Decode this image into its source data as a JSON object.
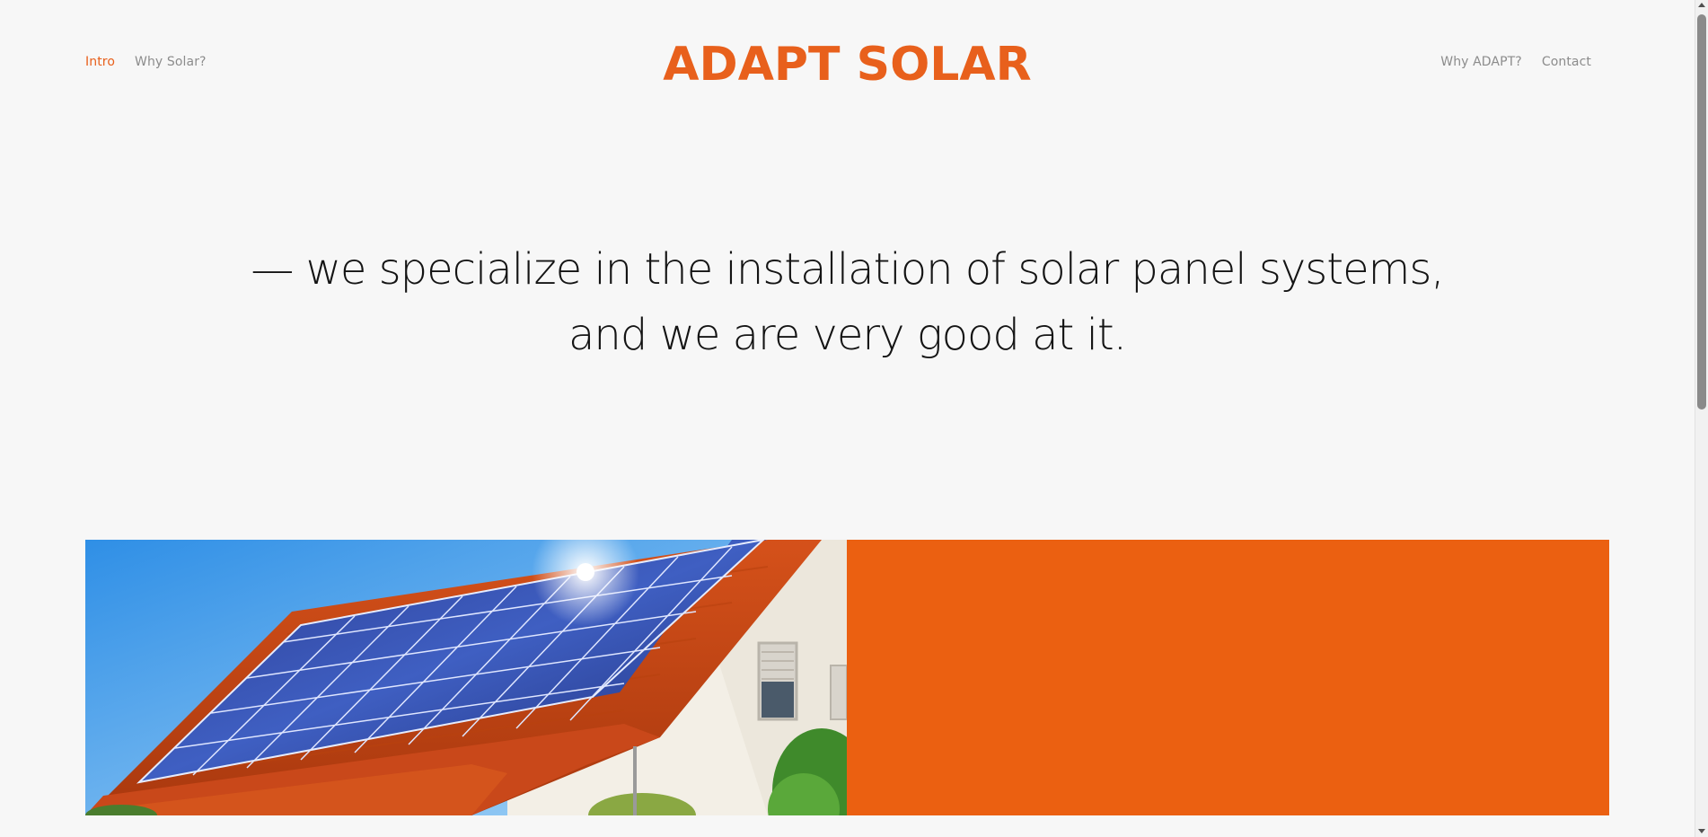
{
  "nav_left": [
    {
      "label": "Intro",
      "active": true
    },
    {
      "label": "Why Solar?",
      "active": false
    }
  ],
  "nav_right": [
    {
      "label": "Why ADAPT?"
    },
    {
      "label": "Contact"
    }
  ],
  "brand": {
    "name": "ADAPT SOLAR"
  },
  "hero": {
    "line1": "— we specialize in the installation of solar panel systems,",
    "line2": "and we are very good at it."
  },
  "colors": {
    "accent": "#e8601c",
    "block": "#eb6011",
    "background": "#f7f7f7",
    "text": "#141414",
    "nav_text": "#8c8c8c"
  },
  "feature": {
    "image": "house-with-rooftop-solar-panels"
  }
}
